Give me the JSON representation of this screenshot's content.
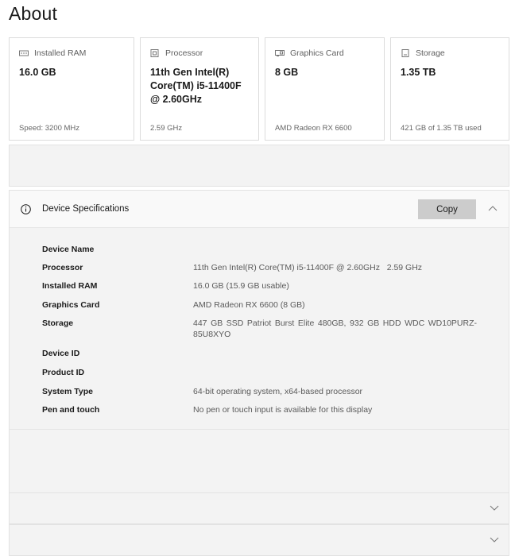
{
  "page": {
    "title": "About"
  },
  "cards": [
    {
      "icon": "ram-icon",
      "label": "Installed RAM",
      "value": "16.0 GB",
      "sub": "Speed: 3200 MHz"
    },
    {
      "icon": "processor-icon",
      "label": "Processor",
      "value": "11th Gen Intel(R) Core(TM) i5-11400F @ 2.60GHz",
      "sub": "2.59 GHz"
    },
    {
      "icon": "graphics-card-icon",
      "label": "Graphics Card",
      "value": "8 GB",
      "sub": "AMD Radeon RX 6600"
    },
    {
      "icon": "storage-icon",
      "label": "Storage",
      "value": "1.35 TB",
      "sub": "421 GB of 1.35 TB used"
    }
  ],
  "specs": {
    "title": "Device Specifications",
    "copy_label": "Copy",
    "rows": [
      {
        "label": "Device Name",
        "value": ""
      },
      {
        "label": "Processor",
        "value": "11th Gen Intel(R) Core(TM) i5-11400F @ 2.60GHz   2.59 GHz"
      },
      {
        "label": "Installed RAM",
        "value": "16.0 GB (15.9 GB usable)"
      },
      {
        "label": "Graphics Card",
        "value": "AMD Radeon RX 6600 (8 GB)"
      },
      {
        "label": "Storage",
        "value": "447 GB SSD Patriot Burst Elite 480GB, 932 GB HDD WDC WD10PURZ-85U8XYO"
      },
      {
        "label": "Device ID",
        "value": ""
      },
      {
        "label": "Product ID",
        "value": ""
      },
      {
        "label": "System Type",
        "value": "64-bit operating system, x64-based processor"
      },
      {
        "label": "Pen and touch",
        "value": "No pen or touch input is available for this display"
      }
    ]
  }
}
